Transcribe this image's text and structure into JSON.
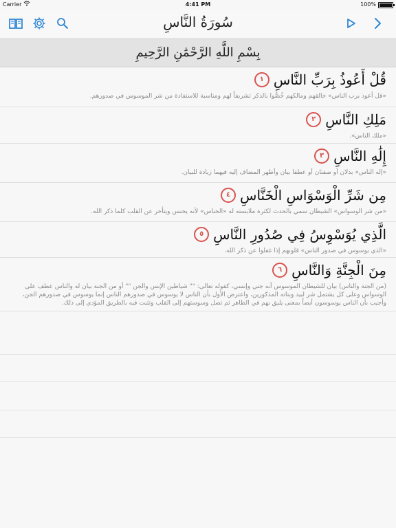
{
  "status_bar": {
    "carrier": "Carrier",
    "time": "4:41 PM",
    "battery": "100%"
  },
  "toolbar": {
    "title": "سُورَةُ النَّاسِ",
    "icons": {
      "book": "book-icon",
      "settings": "gear-icon",
      "search": "search-icon",
      "play": "play-icon",
      "next": "chevron-right-icon"
    }
  },
  "bismillah": "بِسْمِ اللَّهِ الرَّحْمَٰنِ الرَّحِيمِ",
  "ayahs": [
    {
      "text": "قُلْ أَعُوذُ بِرَبِّ النَّاسِ",
      "number": "١",
      "tafsir": "«قل أعوذ برب الناس» خالقهم ومالكهم خُصُّوا بالذكر تشريفاً لهم ومناسبة للاستفادة من شر الموسوس في صدورهم."
    },
    {
      "text": "مَلِكِ النَّاسِ",
      "number": "٢",
      "tafsir": "«ملك الناس»."
    },
    {
      "text": "إِلَٰهِ النَّاسِ",
      "number": "٣",
      "tafsir": "«إله الناس» بدلان أو صفتان أو عطفا بيان وأظهر المضاف إليه فيهما زيادة للبيان."
    },
    {
      "text": "مِن شَرِّ الْوَسْوَاسِ الْخَنَّاسِ",
      "number": "٤",
      "tafsir": "«من شر الوسواس» الشيطان سمي بالحدث لكثرة ملابسته له «الخناس» لأنه يخنس ويتأخر عن القلب كلما ذكر الله."
    },
    {
      "text": "الَّذِي يُوَسْوِسُ فِي صُدُورِ النَّاسِ",
      "number": "٥",
      "tafsir": "«الذي يوسوس في صدور الناس» قلوبهم إذا غفلوا عن ذكر الله."
    },
    {
      "text": "مِنَ الْجِنَّةِ وَالنَّاسِ",
      "number": "٦",
      "tafsir": "(من الجنة والناس) بيان للشيطان الموسوس أنه جني وإنسي، كقوله تعالى: \"\" شياطين الإنس والجن \"\" أو من الجنة بيان له والناس عطف على الوسواس وعلى كل يشتمل شر لبيد وبناته المذكورين، واعترض الأول بأن الناس لا يوسوس في صدورهم الناس إنما يوسوس في صدورهم الجن، وأجيب بأن الناس يوسوسون أيضاً بمعنى يليق بهم في الظاهر ثم تصل وسوستهم إلى القلب وتثبت فيه بالطريق المؤدي إلى ذلك."
    }
  ]
}
